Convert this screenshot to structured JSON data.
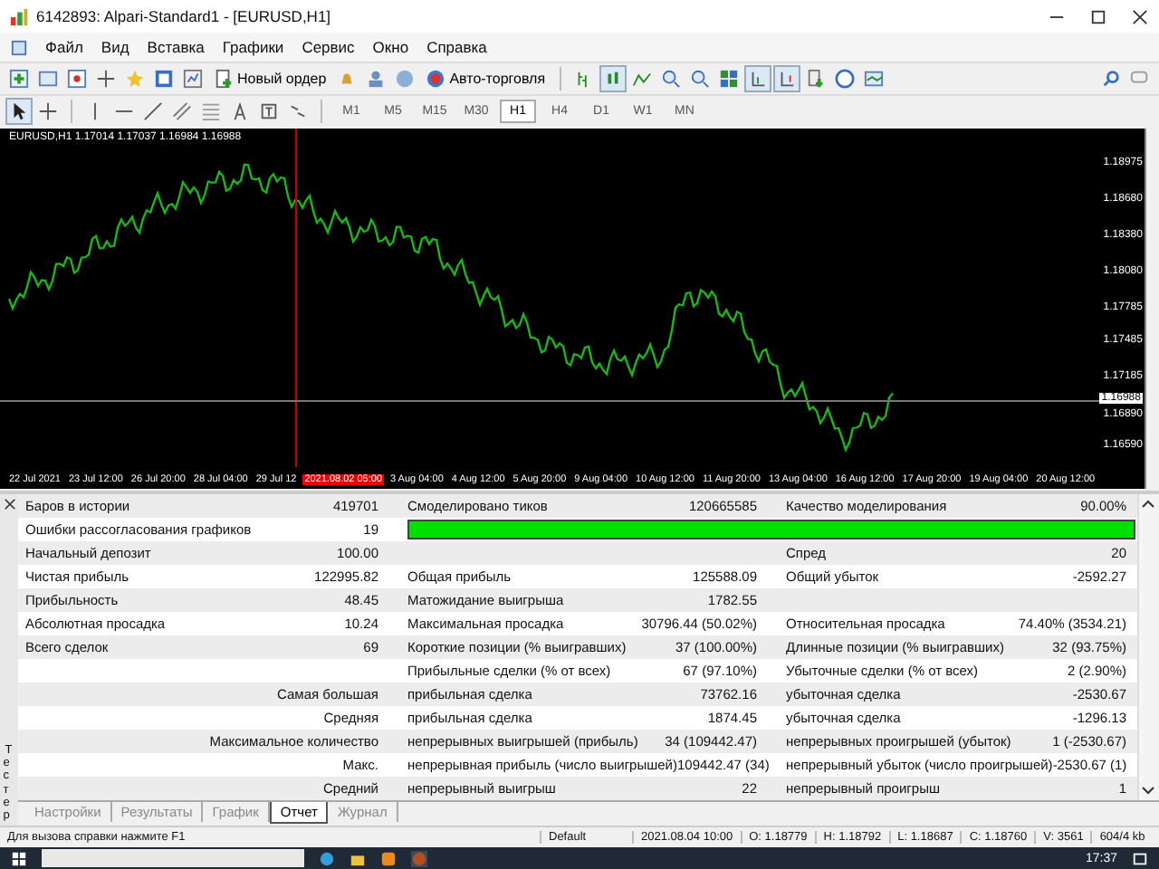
{
  "window": {
    "title": "6142893: Alpari-Standard1 - [EURUSD,H1]"
  },
  "menu": [
    "Файл",
    "Вид",
    "Вставка",
    "Графики",
    "Сервис",
    "Окно",
    "Справка"
  ],
  "toolbar": {
    "buttons": [
      {
        "label": "Новый ордер"
      },
      {
        "label": "Авто-торговля"
      }
    ]
  },
  "timeframes": [
    {
      "label": "M1",
      "selected": false
    },
    {
      "label": "M5",
      "selected": false
    },
    {
      "label": "M15",
      "selected": false
    },
    {
      "label": "M30",
      "selected": false
    },
    {
      "label": "H1",
      "selected": true
    },
    {
      "label": "H4",
      "selected": false
    },
    {
      "label": "D1",
      "selected": false
    },
    {
      "label": "W1",
      "selected": false
    },
    {
      "label": "MN",
      "selected": false
    }
  ],
  "chart": {
    "info": "EURUSD,H1  1.17014 1.17037 1.16984 1.16988",
    "price_labels": [
      {
        "label": "1.18975",
        "kind": "tick"
      },
      {
        "label": "1.18680",
        "kind": "tick"
      },
      {
        "label": "1.18380",
        "kind": "tick"
      },
      {
        "label": "1.18080",
        "kind": "tick"
      },
      {
        "label": "1.17785",
        "kind": "tick"
      },
      {
        "label": "1.17485",
        "kind": "tick"
      },
      {
        "label": "1.17185",
        "kind": "tick"
      },
      {
        "label": "1.16988",
        "kind": "current"
      },
      {
        "label": "1.16890",
        "kind": "tick"
      },
      {
        "label": "1.16590",
        "kind": "tick"
      }
    ],
    "time_labels": [
      {
        "label": "22 Jul 2021",
        "kind": "tick"
      },
      {
        "label": "23 Jul 12:00",
        "kind": "tick"
      },
      {
        "label": "26 Jul 20:00",
        "kind": "tick"
      },
      {
        "label": "28 Jul 04:00",
        "kind": "tick"
      },
      {
        "label": "29 Jul 12",
        "kind": "tick"
      },
      {
        "label": "2021.08.02 05:00",
        "kind": "cursor"
      },
      {
        "label": "3 Aug 04:00",
        "kind": "tick"
      },
      {
        "label": "4 Aug 12:00",
        "kind": "tick"
      },
      {
        "label": "5 Aug 20:00",
        "kind": "tick"
      },
      {
        "label": "9 Aug 04:00",
        "kind": "tick"
      },
      {
        "label": "10 Aug 12:00",
        "kind": "tick"
      },
      {
        "label": "11 Aug 20:00",
        "kind": "tick"
      },
      {
        "label": "13 Aug 04:00",
        "kind": "tick"
      },
      {
        "label": "16 Aug 12:00",
        "kind": "tick"
      },
      {
        "label": "17 Aug 20:00",
        "kind": "tick"
      },
      {
        "label": "19 Aug 04:00",
        "kind": "tick"
      },
      {
        "label": "20 Aug 12:00",
        "kind": "tick"
      }
    ]
  },
  "tester": {
    "side_label": "Тестер",
    "rows": [
      {
        "kind": "pairs",
        "c1": {
          "label": "Баров в истории",
          "value": "419701"
        },
        "c2": {
          "label": "Смоделировано тиков",
          "value": "120665585"
        },
        "c3": {
          "label": "Качество моделирования",
          "value": "90.00%"
        }
      },
      {
        "kind": "quality_bar",
        "c1": {
          "label": "Ошибки рассогласования графиков",
          "value": "19"
        }
      },
      {
        "kind": "pairs",
        "c1": {
          "label": "Начальный депозит",
          "value": "100.00"
        },
        "c3": {
          "label": "Спред",
          "value": "20"
        }
      },
      {
        "kind": "pairs",
        "c1": {
          "label": "Чистая прибыль",
          "value": "122995.82"
        },
        "c2": {
          "label": "Общая прибыль",
          "value": "125588.09"
        },
        "c3": {
          "label": "Общий убыток",
          "value": "-2592.27"
        }
      },
      {
        "kind": "pairs",
        "c1": {
          "label": "Прибыльность",
          "value": "48.45"
        },
        "c2": {
          "label": "Матожидание выигрыша",
          "value": "1782.55"
        }
      },
      {
        "kind": "pairs",
        "c1": {
          "label": "Абсолютная просадка",
          "value": "10.24"
        },
        "c2": {
          "label": "Максимальная просадка",
          "value": "30796.44 (50.02%)"
        },
        "c3": {
          "label": "Относительная просадка",
          "value": "74.40% (3534.21)"
        }
      },
      {
        "kind": "pairs",
        "c1": {
          "label": "Всего сделок",
          "value": "69"
        },
        "c2": {
          "label": "Короткие позиции (% выигравших)",
          "value": "37 (100.00%)"
        },
        "c3": {
          "label": "Длинные позиции (% выигравших)",
          "value": "32 (93.75%)"
        }
      },
      {
        "kind": "pairs",
        "c2": {
          "label": "Прибыльные сделки (% от всех)",
          "value": "67 (97.10%)"
        },
        "c3": {
          "label": "Убыточные сделки (% от всех)",
          "value": "2 (2.90%)"
        }
      },
      {
        "kind": "group",
        "heading": "Самая большая",
        "c2": {
          "label": "прибыльная сделка",
          "value": "73762.16"
        },
        "c3": {
          "label": "убыточная сделка",
          "value": "-2530.67"
        }
      },
      {
        "kind": "group",
        "heading": "Средняя",
        "c2": {
          "label": "прибыльная сделка",
          "value": "1874.45"
        },
        "c3": {
          "label": "убыточная сделка",
          "value": "-1296.13"
        }
      },
      {
        "kind": "group",
        "heading": "Максимальное количество",
        "c2": {
          "label": "непрерывных выигрышей (прибыль)",
          "value": "34 (109442.47)"
        },
        "c3": {
          "label": "непрерывных проигрышей (убыток)",
          "value": "1 (-2530.67)"
        }
      },
      {
        "kind": "group",
        "heading": "Макс.",
        "c2": {
          "label": "непрерывная прибыль (число выигрышей)",
          "value": "109442.47 (34)"
        },
        "c3": {
          "label": "непрерывный убыток (число проигрышей)",
          "value": "-2530.67 (1)"
        }
      },
      {
        "kind": "group",
        "heading": "Средний",
        "c2": {
          "label": "непрерывный выигрыш",
          "value": "22"
        },
        "c3": {
          "label": "непрерывный проигрыш",
          "value": "1"
        }
      }
    ],
    "tabs": [
      {
        "label": "Настройки",
        "selected": false
      },
      {
        "label": "Результаты",
        "selected": false
      },
      {
        "label": "График",
        "selected": false
      },
      {
        "label": "Отчет",
        "selected": true
      },
      {
        "label": "Журнал",
        "selected": false
      }
    ]
  },
  "status_bar": [
    "Для вызова справки нажмите F1",
    "Default",
    "2021.08.04 10:00",
    "O: 1.18779",
    "H: 1.18792",
    "L: 1.18687",
    "C: 1.18760",
    "V: 3561",
    "604/4 kb"
  ],
  "taskbar": {
    "time": "17:37"
  }
}
